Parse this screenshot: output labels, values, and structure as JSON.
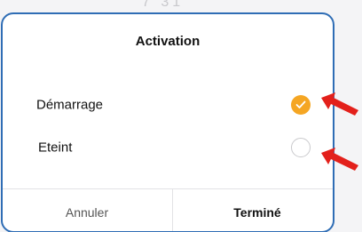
{
  "background": {
    "time_fragment": "7 31"
  },
  "dialog": {
    "title": "Activation",
    "options": [
      {
        "label": "Démarrage",
        "selected": true
      },
      {
        "label": "Eteint",
        "selected": false
      }
    ],
    "cancel_label": "Annuler",
    "done_label": "Terminé"
  },
  "colors": {
    "accent": "#f5a623",
    "frame_border": "#2f6db5",
    "annotation_arrow": "#e3201b"
  },
  "icons": {
    "selected_radio": "check-circle-icon",
    "unselected_radio": "empty-circle-icon",
    "annotation": "red-arrow-icon"
  }
}
